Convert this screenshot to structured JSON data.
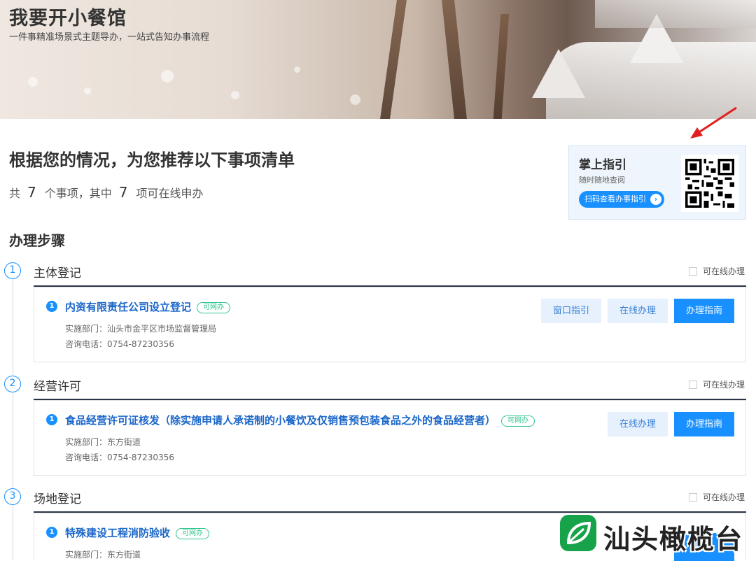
{
  "banner": {
    "title": "我要开小餐馆",
    "subtitle": "一件事精准场景式主题导办，一站式告知办事流程"
  },
  "recommendation": {
    "title": "根据您的情况，为您推荐以下事项清单",
    "count_prefix": "共",
    "total": "7",
    "count_mid": "个事项，其中",
    "online": "7",
    "count_suffix": "项可在线申办"
  },
  "qr_card": {
    "title": "掌上指引",
    "subtitle": "随时随地查阅",
    "button_label": "扫码查看办事指引",
    "qr_icon": "qr-code-icon"
  },
  "steps_title": "办理步骤",
  "online_filter_label": "可在线办理",
  "steps": [
    {
      "num": "1",
      "name": "主体登记",
      "item": {
        "index": "1",
        "name": "内资有限责任公司设立登记",
        "tag": "可网办",
        "dept": "实施部门：汕头市金平区市场监督管理局",
        "phone": "咨询电话：0754-87230356",
        "buttons": [
          "窗口指引",
          "在线办理",
          "办理指南"
        ]
      }
    },
    {
      "num": "2",
      "name": "经营许可",
      "item": {
        "index": "1",
        "name": "食品经营许可证核发（除实施申请人承诺制的小餐饮及仅销售预包装食品之外的食品经营者）",
        "tag": "可网办",
        "dept": "实施部门：东方街道",
        "phone": "咨询电话：0754-87230356",
        "buttons": [
          "在线办理",
          "办理指南"
        ]
      }
    },
    {
      "num": "3",
      "name": "场地登记",
      "item": {
        "index": "1",
        "name": "特殊建设工程消防验收",
        "tag": "可网办",
        "dept": "实施部门：东方街道"
      }
    }
  ],
  "watermark": {
    "text": "汕头橄榄台"
  },
  "colors": {
    "primary": "#1890ff",
    "link": "#1a66c9",
    "tag": "#31c48d",
    "rule": "#2b3447"
  }
}
